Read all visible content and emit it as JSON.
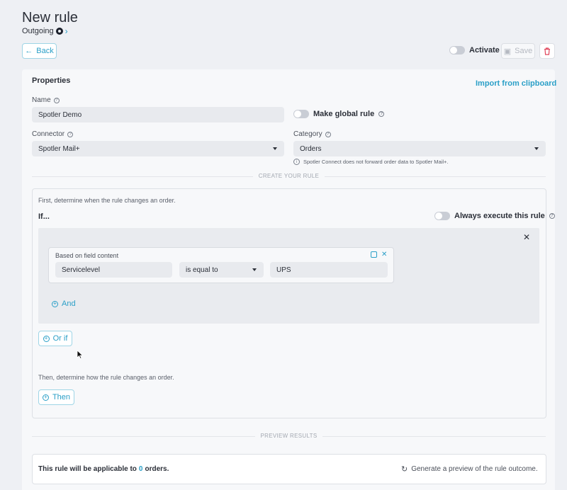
{
  "header": {
    "title": "New rule",
    "breadcrumb": "Outgoing"
  },
  "toolbar": {
    "back_label": "Back",
    "activate_label": "Activate",
    "save_label": "Save"
  },
  "properties": {
    "heading": "Properties",
    "import_label": "Import from clipboard",
    "name_label": "Name",
    "name_value": "Spotler Demo",
    "global_rule_label": "Make global rule",
    "connector_label": "Connector",
    "connector_value": "Spotler Mail+",
    "category_label": "Category",
    "category_value": "Orders",
    "category_info": "Spotler Connect does not forward order data to Spotler Mail+."
  },
  "rule": {
    "divider": "CREATE YOUR RULE",
    "intro": "First, determine when the rule changes an order.",
    "if_label": "If...",
    "always_label": "Always execute this rule",
    "condition_title": "Based on field content",
    "field": "Servicelevel",
    "operator": "is equal to",
    "value": "UPS",
    "and_label": "And",
    "or_if_label": "Or if",
    "then_intro": "Then, determine how the rule changes an order.",
    "then_label": "Then"
  },
  "preview": {
    "divider": "PREVIEW RESULTS",
    "applicable_prefix": "This rule will be applicable to",
    "count": "0",
    "applicable_suffix": "orders.",
    "generate_label": "Generate a preview of the rule outcome."
  },
  "colors": {
    "accent": "#2a9fc7",
    "background": "#eef0f4",
    "danger": "#e0445a"
  }
}
